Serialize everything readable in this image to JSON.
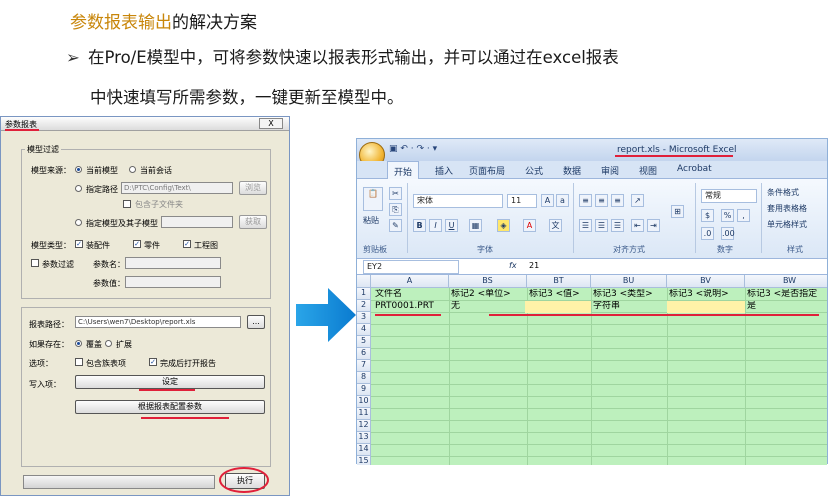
{
  "slide": {
    "title_highlight": "参数报表输出",
    "title_rest": "的解决方案",
    "bullet_mark": "➢",
    "bullet_line1": "在Pro/E模型中，可将参数快速以报表形式输出，并可以通过在excel报表",
    "bullet_line2": "中快速填写所需参数，一键更新至模型中。"
  },
  "dialog": {
    "title": "参数报表",
    "close": "X",
    "model_filter_group": "模型过滤",
    "source_label": "模型来源：",
    "current_model": "当前模型",
    "current_session": "当前会话",
    "specify_path": "指定路径",
    "path_value": "D:\\PTC\\Config\\Text\\",
    "browse": "浏览",
    "include_subfolders": "包含子文件夹",
    "specify_model": "指定模型及其子模型",
    "get": "获取",
    "model_type_label": "模型类型：",
    "type_assembly": "装配件",
    "type_part": "零件",
    "type_drawing": "工程图",
    "param_filter": "参数过滤",
    "param_name_label": "参数名：",
    "param_value_label": "参数值：",
    "report_path_label": "报表路径：",
    "report_path_value": "C:\\Users\\wen7\\Desktop\\report.xls",
    "report_path_btn": "...",
    "if_exists_label": "如果存在：",
    "overwrite": "覆盖",
    "extend": "扩展",
    "options_label": "选项：",
    "include_family": "包含族表项",
    "open_after": "完成后打开报告",
    "write_items_label": "写入项：",
    "settings_btn": "设定",
    "config_btn": "根据报表配置参数",
    "execute_btn": "执行"
  },
  "excel": {
    "window_title": "report.xls - Microsoft Excel",
    "tabs": [
      "开始",
      "插入",
      "页面布局",
      "公式",
      "数据",
      "审阅",
      "视图",
      "Acrobat"
    ],
    "font_name": "宋体",
    "font_size": "11",
    "number_format": "常规",
    "groups": [
      "剪贴板",
      "字体",
      "对齐方式",
      "数字",
      "样式"
    ],
    "paste_label": "粘贴",
    "style_items": [
      "条件格式",
      "套用表格格",
      "单元格样式"
    ],
    "name_box": "EY2",
    "fx": "fx",
    "formula_value": "21",
    "col_headers": [
      "A",
      "BS",
      "BT",
      "BU",
      "BV",
      "BW"
    ],
    "row_numbers": [
      "1",
      "2",
      "3",
      "4",
      "5",
      "6",
      "7",
      "8",
      "9",
      "10",
      "11",
      "12",
      "13",
      "14",
      "15"
    ],
    "row1": [
      "文件名",
      "标记2 <单位>",
      "标记3 <值>",
      "标记3 <类型>",
      "标记3 <说明>",
      "标记3 <是否指定"
    ],
    "row2": [
      "PRT0001.PRT",
      "无",
      "",
      "字符串",
      "",
      "是"
    ]
  }
}
